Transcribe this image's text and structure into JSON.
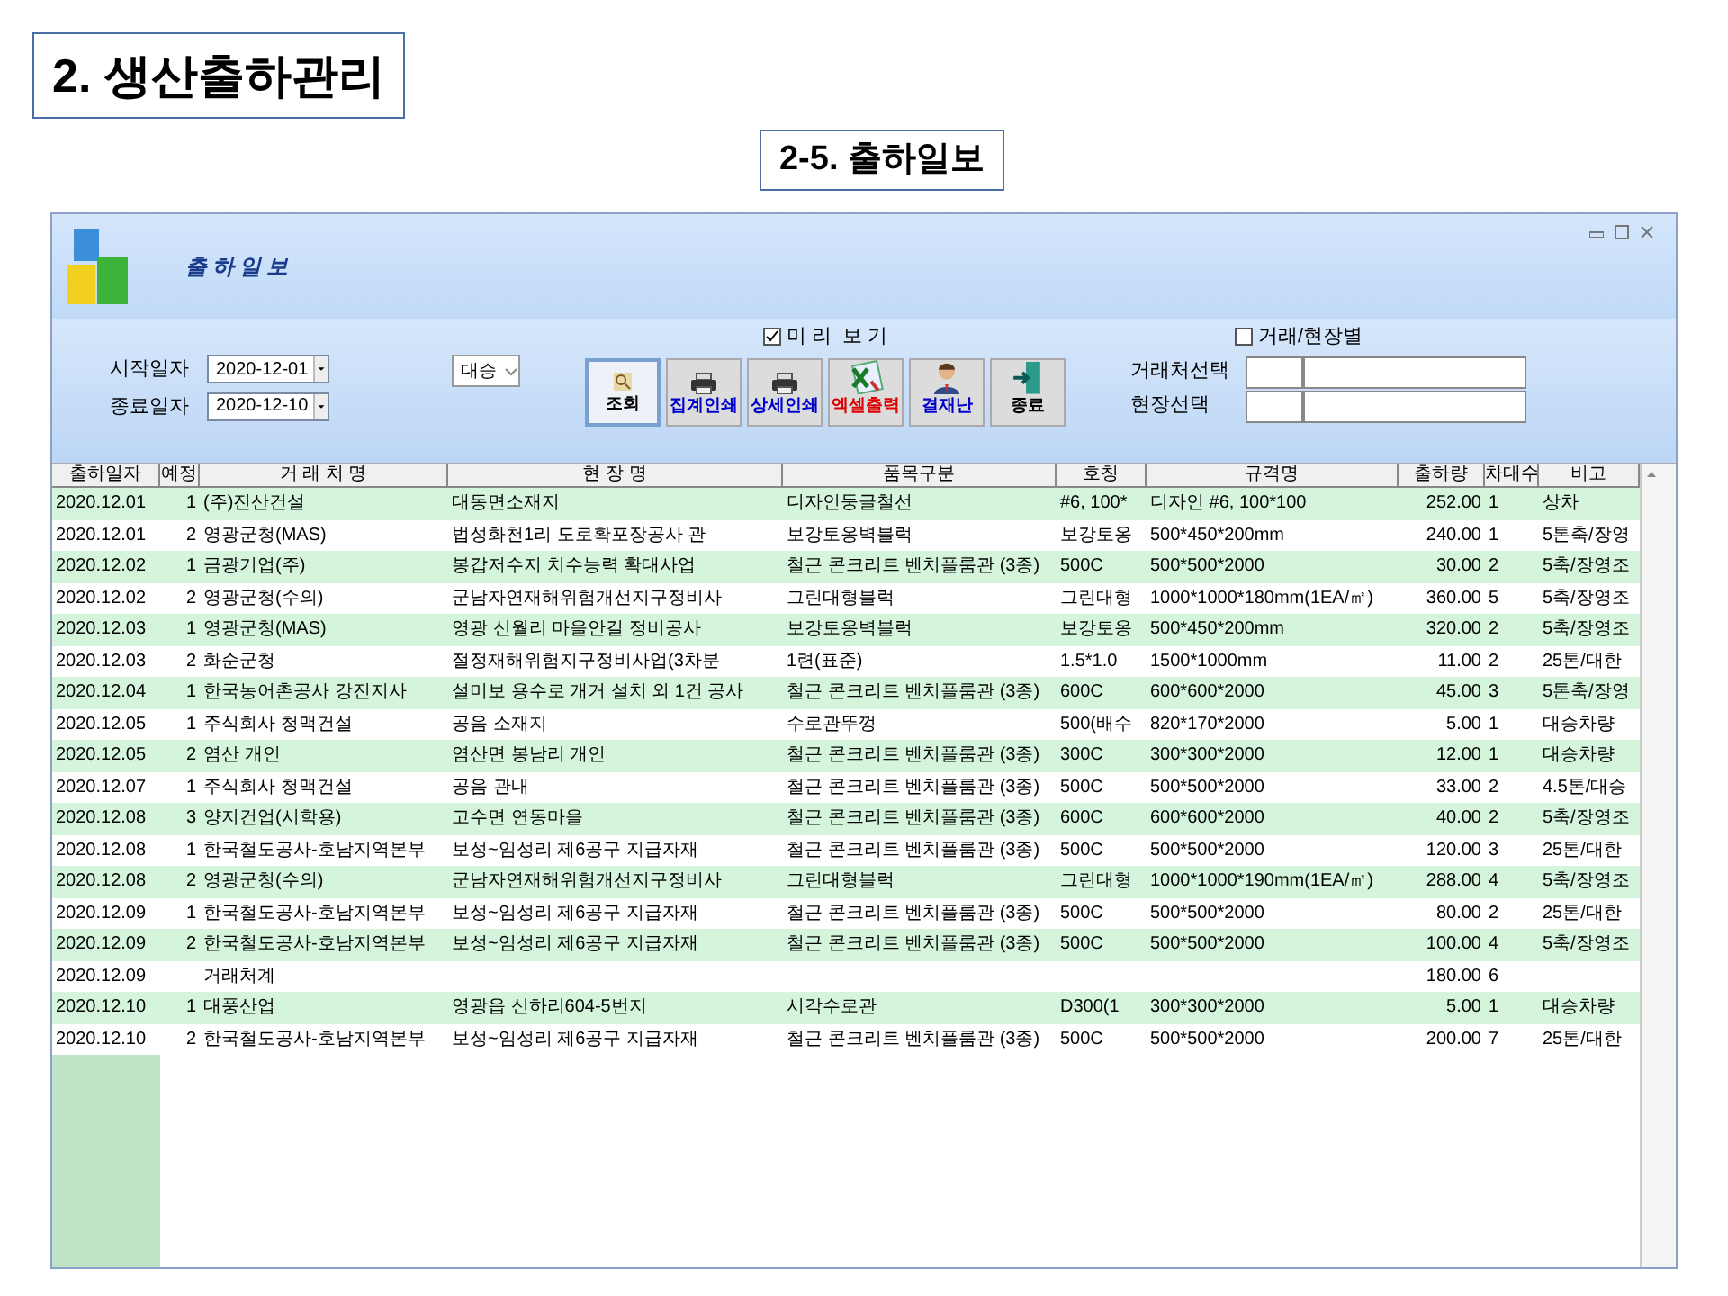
{
  "slide_title": "2. 생산출하관리",
  "section_title": "2-5. 출하일보",
  "window": {
    "title": "출하일보"
  },
  "filters": {
    "start_label": "시작일자",
    "start_value": "2020-12-01",
    "end_label": "종료일자",
    "end_value": "2020-12-10",
    "company_value": "대승"
  },
  "preview": {
    "label": "미 리  보 기",
    "checked": true
  },
  "by_site": {
    "label": "거래/현장별",
    "checked": false
  },
  "buttons": [
    {
      "kind": "search",
      "label": "조회",
      "color": "#000000"
    },
    {
      "kind": "print",
      "label": "집계인쇄",
      "color": "#0000cc"
    },
    {
      "kind": "print",
      "label": "상세인쇄",
      "color": "#0000cc"
    },
    {
      "kind": "excel",
      "label": "엑셀출력",
      "color": "#dd0000"
    },
    {
      "kind": "approver",
      "label": "결재난",
      "color": "#0000cc"
    },
    {
      "kind": "exit",
      "label": "종료",
      "color": "#000000"
    }
  ],
  "select_fields": [
    {
      "label": "거래처선택"
    },
    {
      "label": "현장선택"
    }
  ],
  "table": {
    "columns": [
      "출하일자",
      "예정",
      "거 래 처 명",
      "현 장 명",
      "품목구분",
      "호칭",
      "규격명",
      "출하량",
      "차대수",
      "비고"
    ],
    "rows": [
      {
        "date": "2020.12.01",
        "seq": "1",
        "client": "(주)진산건설",
        "site": "대동면소재지",
        "item": "디자인둥글철선",
        "size": "#6, 100*",
        "spec": "디자인 #6, 100*100",
        "qty": "252.00",
        "trucks": "1",
        "note": "상차"
      },
      {
        "date": "2020.12.01",
        "seq": "2",
        "client": "영광군청(MAS)",
        "site": "법성화천1리 도로확포장공사 관",
        "item": "보강토옹벽블럭",
        "size": "보강토옹",
        "spec": "500*450*200mm",
        "qty": "240.00",
        "trucks": "1",
        "note": "5톤축/장영"
      },
      {
        "date": "2020.12.02",
        "seq": "1",
        "client": "금광기업(주)",
        "site": "봉갑저수지 치수능력 확대사업",
        "item": "철근 콘크리트 벤치플룸관 (3종)",
        "size": "500C",
        "spec": "500*500*2000",
        "qty": "30.00",
        "trucks": "2",
        "note": "5축/장영조"
      },
      {
        "date": "2020.12.02",
        "seq": "2",
        "client": "영광군청(수의)",
        "site": "군남자연재해위험개선지구정비사",
        "item": "그린대형블럭",
        "size": "그린대형",
        "spec": "1000*1000*180mm(1EA/㎡)",
        "qty": "360.00",
        "trucks": "5",
        "note": "5축/장영조"
      },
      {
        "date": "2020.12.03",
        "seq": "1",
        "client": "영광군청(MAS)",
        "site": "영광 신월리 마을안길 정비공사",
        "item": "보강토옹벽블럭",
        "size": "보강토옹",
        "spec": "500*450*200mm",
        "qty": "320.00",
        "trucks": "2",
        "note": "5축/장영조"
      },
      {
        "date": "2020.12.03",
        "seq": "2",
        "client": "화순군청",
        "site": "절정재해위험지구정비사업(3차분",
        "item": "1련(표준)",
        "size": "1.5*1.0",
        "spec": "1500*1000mm",
        "qty": "11.00",
        "trucks": "2",
        "note": "25톤/대한"
      },
      {
        "date": "2020.12.04",
        "seq": "1",
        "client": "한국농어촌공사 강진지사",
        "site": "설미보 용수로 개거 설치 외 1건 공사",
        "item": "철근 콘크리트 벤치플룸관 (3종)",
        "size": "600C",
        "spec": "600*600*2000",
        "qty": "45.00",
        "trucks": "3",
        "note": "5톤축/장영"
      },
      {
        "date": "2020.12.05",
        "seq": "1",
        "client": "주식회사 청맥건설",
        "site": "공음 소재지",
        "item": "수로관뚜껑",
        "size": "500(배수",
        "spec": "820*170*2000",
        "qty": "5.00",
        "trucks": "1",
        "note": "대승차량"
      },
      {
        "date": "2020.12.05",
        "seq": "2",
        "client": "염산 개인",
        "site": "염산면 봉남리 개인",
        "item": "철근 콘크리트 벤치플룸관 (3종)",
        "size": "300C",
        "spec": "300*300*2000",
        "qty": "12.00",
        "trucks": "1",
        "note": "대승차량"
      },
      {
        "date": "2020.12.07",
        "seq": "1",
        "client": "주식회사 청맥건설",
        "site": "공음 관내",
        "item": "철근 콘크리트 벤치플룸관 (3종)",
        "size": "500C",
        "spec": "500*500*2000",
        "qty": "33.00",
        "trucks": "2",
        "note": "4.5톤/대승"
      },
      {
        "date": "2020.12.08",
        "seq": "3",
        "client": "양지건업(시학용)",
        "site": "고수면 연동마을",
        "item": "철근 콘크리트 벤치플룸관 (3종)",
        "size": "600C",
        "spec": "600*600*2000",
        "qty": "40.00",
        "trucks": "2",
        "note": "5축/장영조"
      },
      {
        "date": "2020.12.08",
        "seq": "1",
        "client": "한국철도공사-호남지역본부",
        "site": "보성~임성리 제6공구 지급자재",
        "item": "철근 콘크리트 벤치플룸관 (3종)",
        "size": "500C",
        "spec": "500*500*2000",
        "qty": "120.00",
        "trucks": "3",
        "note": "25톤/대한"
      },
      {
        "date": "2020.12.08",
        "seq": "2",
        "client": "영광군청(수의)",
        "site": "군남자연재해위험개선지구정비사",
        "item": "그린대형블럭",
        "size": "그린대형",
        "spec": "1000*1000*190mm(1EA/㎡)",
        "qty": "288.00",
        "trucks": "4",
        "note": "5축/장영조"
      },
      {
        "date": "2020.12.09",
        "seq": "1",
        "client": "한국철도공사-호남지역본부",
        "site": "보성~임성리 제6공구 지급자재",
        "item": "철근 콘크리트 벤치플룸관 (3종)",
        "size": "500C",
        "spec": "500*500*2000",
        "qty": "80.00",
        "trucks": "2",
        "note": "25톤/대한"
      },
      {
        "date": "2020.12.09",
        "seq": "2",
        "client": "한국철도공사-호남지역본부",
        "site": "보성~임성리 제6공구 지급자재",
        "item": "철근 콘크리트 벤치플룸관 (3종)",
        "size": "500C",
        "spec": "500*500*2000",
        "qty": "100.00",
        "trucks": "4",
        "note": "5축/장영조"
      },
      {
        "date": "2020.12.09",
        "client": "거래처계",
        "qty": "180.00",
        "trucks": "6"
      },
      {
        "date": "2020.12.10",
        "seq": "1",
        "client": "대풍산업",
        "site": "영광읍 신하리604-5번지",
        "item": "시각수로관",
        "size": "D300(1",
        "spec": "300*300*2000",
        "qty": "5.00",
        "trucks": "1",
        "note": "대승차량"
      },
      {
        "date": "2020.12.10",
        "seq": "2",
        "client": "한국철도공사-호남지역본부",
        "site": "보성~임성리 제6공구 지급자재",
        "item": "철근 콘크리트 벤치플룸관 (3종)",
        "size": "500C",
        "spec": "500*500*2000",
        "qty": "200.00",
        "trucks": "7",
        "note": "25톤/대한"
      }
    ]
  }
}
